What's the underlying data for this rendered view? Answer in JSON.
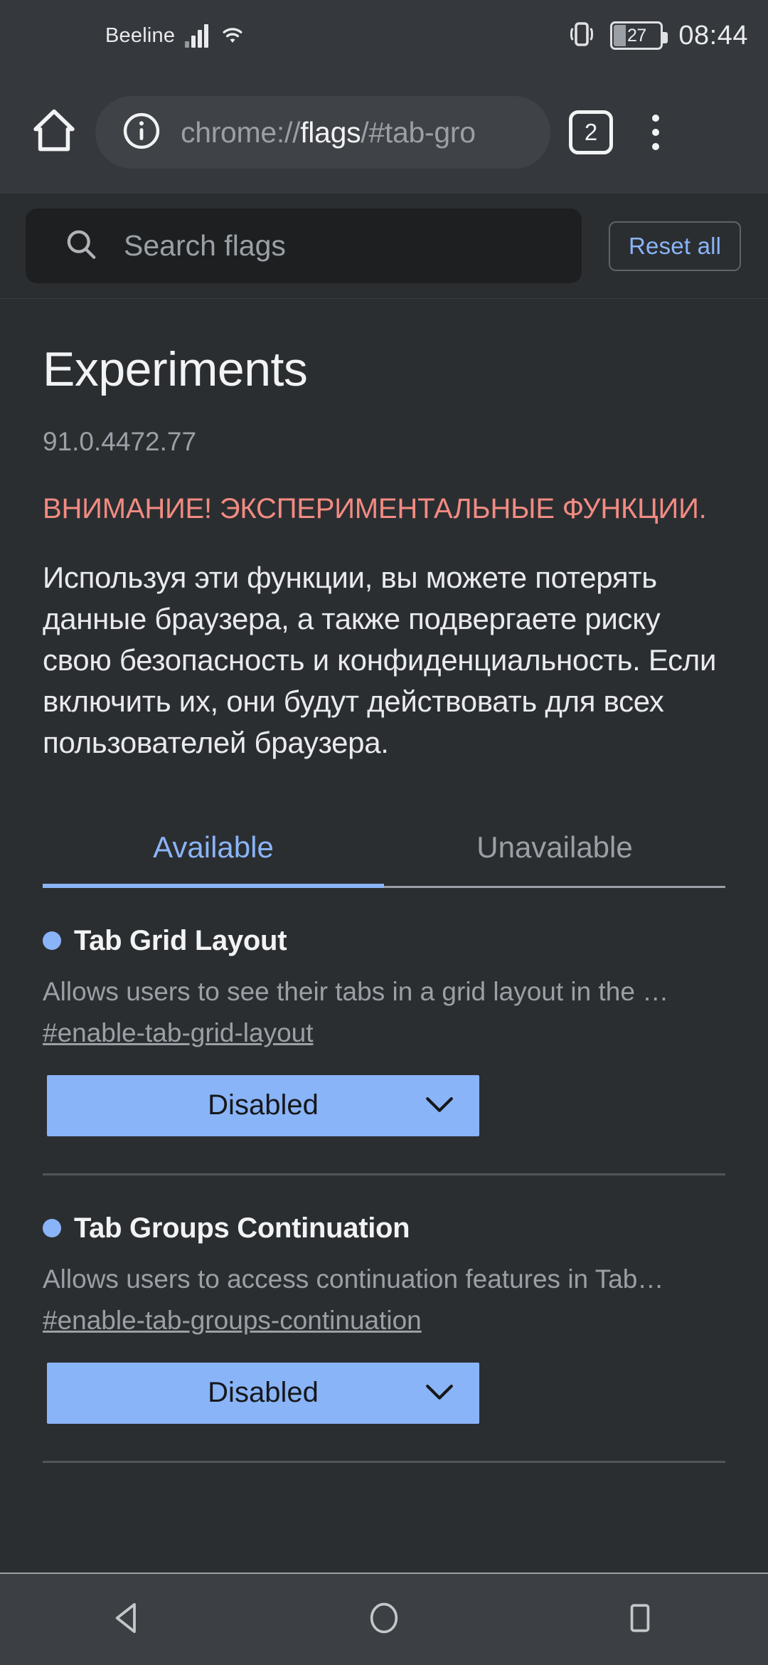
{
  "status_bar": {
    "carrier": "Beeline",
    "battery_percent": "27",
    "time": "08:44",
    "icons": [
      "signal-icon",
      "wifi-icon",
      "vibrate-icon",
      "battery-icon"
    ]
  },
  "browser_toolbar": {
    "home_icon": "home-icon",
    "security_icon": "info-circle-icon",
    "url_prefix": "chrome://",
    "url_emphasis": "flags",
    "url_suffix": "/#tab-gro",
    "tab_count": "2",
    "menu_icon": "three-dot-menu-icon"
  },
  "flags_search": {
    "placeholder": "Search flags",
    "search_icon": "search-icon",
    "reset_label": "Reset all"
  },
  "page": {
    "title": "Experiments",
    "version": "91.0.4472.77",
    "warning": "ВНИМАНИЕ! ЭКСПЕРИМЕНТАЛЬНЫЕ ФУНКЦИИ.",
    "description": "Используя эти функции, вы можете потерять данные браузера, а также подвергаете риску свою безопасность и конфиденциальность. Если включить их, они будут действовать для всех пользователей браузера."
  },
  "tabs": {
    "available_label": "Available",
    "unavailable_label": "Unavailable",
    "active": "Available"
  },
  "flags": [
    {
      "name": "Tab Grid Layout",
      "description": "Allows users to see their tabs in a grid layout in the …",
      "permalink": "#enable-tab-grid-layout",
      "state": "Disabled"
    },
    {
      "name": "Tab Groups Continuation",
      "description": "Allows users to access continuation features in Tab…",
      "permalink": "#enable-tab-groups-continuation",
      "state": "Disabled"
    }
  ],
  "nav_bar": {
    "back": "back-triangle-icon",
    "home": "home-circle-icon",
    "recents": "recents-square-icon"
  },
  "colors": {
    "accent_blue": "#8ab4f8",
    "warning_red": "#f28b82",
    "toolbar_bg": "#35383c",
    "page_bg": "#2b2e31"
  }
}
